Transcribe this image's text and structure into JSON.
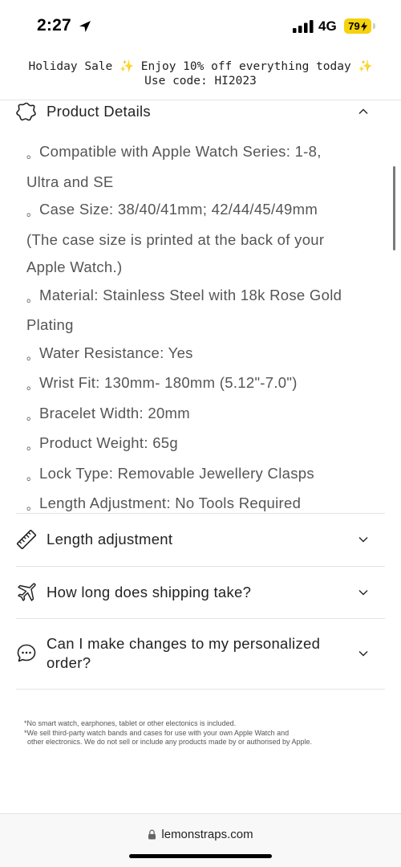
{
  "status_bar": {
    "time": "2:27",
    "network": "4G",
    "battery": "79"
  },
  "announcement": {
    "line1": "Holiday Sale",
    "line1b": "Enjoy 10% off everything today",
    "sparkle": "✨",
    "line2": "Use code: HI2023"
  },
  "product_details": {
    "title": "Product Details",
    "icon": "badge-icon",
    "items": [
      "Compatible with Apple Watch Series: 1-8,",
      "Ultra and SE",
      "Case Size: 38/40/41mm; 42/44/45/49mm",
      "(The case size is printed at the back of your",
      "Apple Watch.)",
      "Material: Stainless Steel with 18k Rose Gold",
      "Plating",
      "Water Resistance: Yes",
      "Wrist Fit: 130mm- 180mm (5.12\"-7.0\")",
      "Bracelet Width: 20mm",
      "Product Weight: 65g",
      "Lock Type: Removable Jewellery Clasps",
      "Length Adjustment: No Tools Required"
    ],
    "bullet": "。"
  },
  "accordions": [
    {
      "title": "Length adjustment",
      "icon": "ruler-icon"
    },
    {
      "title": "How long does shipping take?",
      "icon": "airplane-icon"
    },
    {
      "title_line1": "Can I make changes to my personalized",
      "title_line2": "order?",
      "icon": "chat-bubble-icon"
    }
  ],
  "footnote": {
    "line1": "*No smart watch, earphones, tablet or other electonics is included.",
    "line2": "*We sell third-party watch bands and cases for use with your own Apple Watch and",
    "line3": "other electronics. We do not sell or include any products made by or authorised by Apple."
  },
  "browser": {
    "url": "lemonstraps.com"
  }
}
